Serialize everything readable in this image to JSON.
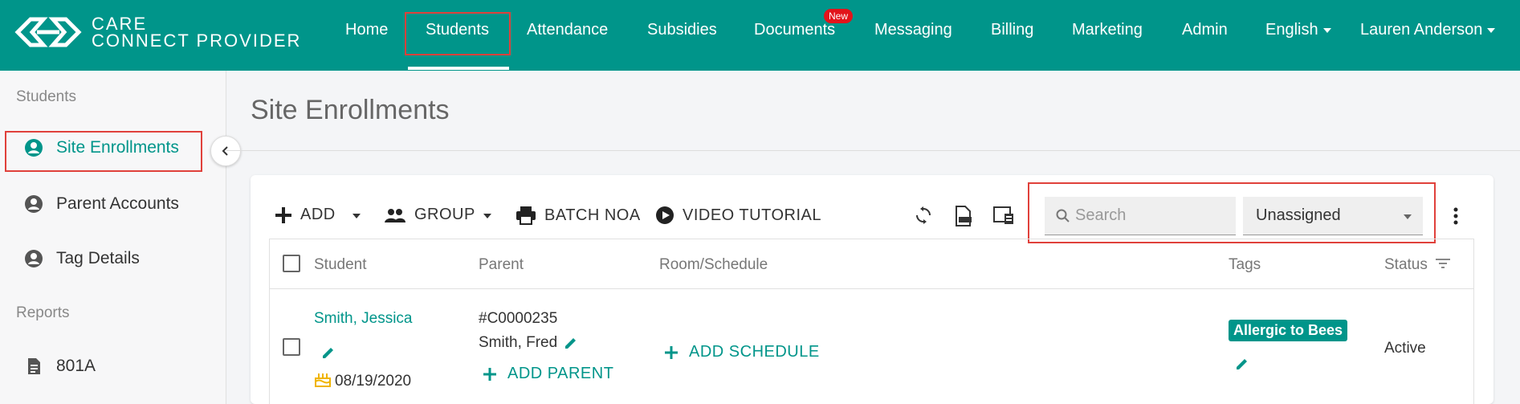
{
  "brand": {
    "line1": "CARE",
    "line2": "CONNECT PROVIDER"
  },
  "nav": {
    "items": [
      "Home",
      "Students",
      "Attendance",
      "Subsidies",
      "Documents",
      "Messaging",
      "Billing",
      "Marketing",
      "Admin"
    ],
    "active": "Students",
    "documents_badge": "New",
    "language": "English",
    "user": "Lauren Anderson"
  },
  "sidebar": {
    "section_students": "Students",
    "items": [
      "Site Enrollments",
      "Parent Accounts",
      "Tag Details"
    ],
    "section_reports": "Reports",
    "report_items": [
      "801A"
    ]
  },
  "page": {
    "title": "Site Enrollments"
  },
  "toolbar": {
    "add": "ADD",
    "group": "GROUP",
    "batch_noa": "BATCH NOA",
    "video_tutorial": "VIDEO TUTORIAL",
    "search_placeholder": "Search",
    "filter_value": "Unassigned"
  },
  "table": {
    "headers": [
      "Student",
      "Parent",
      "Room/Schedule",
      "Tags",
      "Status"
    ],
    "rows": [
      {
        "student": "Smith, Jessica",
        "birthday": "08/19/2020",
        "parent_id": "#C0000235",
        "parent_name": "Smith, Fred",
        "add_parent": "ADD PARENT",
        "add_schedule": "ADD SCHEDULE",
        "tag": "Allergic to Bees",
        "status": "Active"
      }
    ]
  },
  "colors": {
    "brand": "#00958a",
    "highlight": "#e0413b",
    "badge": "#e2141b"
  }
}
